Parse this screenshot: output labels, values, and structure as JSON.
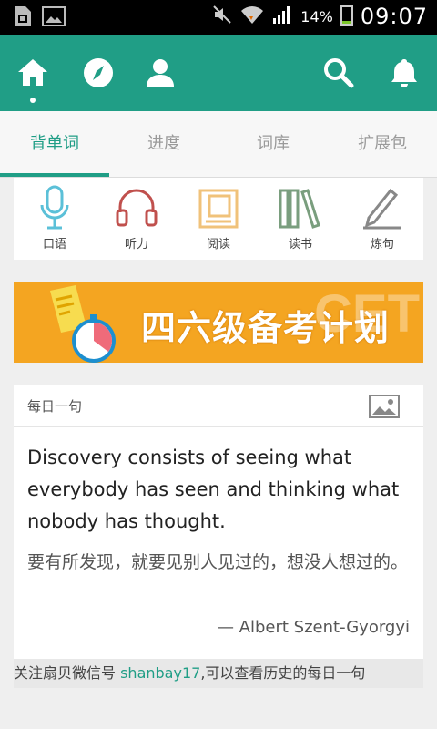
{
  "status_bar": {
    "battery": "14%",
    "time": "09:07"
  },
  "tabs": [
    {
      "label": "背单词",
      "active": true
    },
    {
      "label": "进度",
      "active": false
    },
    {
      "label": "词库",
      "active": false
    },
    {
      "label": "扩展包",
      "active": false
    }
  ],
  "features": [
    {
      "label": "口语",
      "icon": "microphone-icon"
    },
    {
      "label": "听力",
      "icon": "headphones-icon"
    },
    {
      "label": "阅读",
      "icon": "document-icon"
    },
    {
      "label": "读书",
      "icon": "books-icon"
    },
    {
      "label": "炼句",
      "icon": "pencil-icon"
    }
  ],
  "banner": {
    "title": "四六级备考计划",
    "watermark": "CET"
  },
  "daily": {
    "title": "每日一句",
    "quote_en": "Discovery consists of seeing what everybody has seen and thinking what nobody has thought.",
    "quote_cn": "要有所发现，就要见别人见过的，想没人想过的。",
    "author": "— Albert Szent-Gyorgyi"
  },
  "footer": {
    "prefix": "关注扇贝微信号 ",
    "handle": "shanbay17",
    "suffix": ",可以查看历史的每日一句"
  },
  "colors": {
    "brand": "#209e86",
    "banner": "#f4a521"
  }
}
